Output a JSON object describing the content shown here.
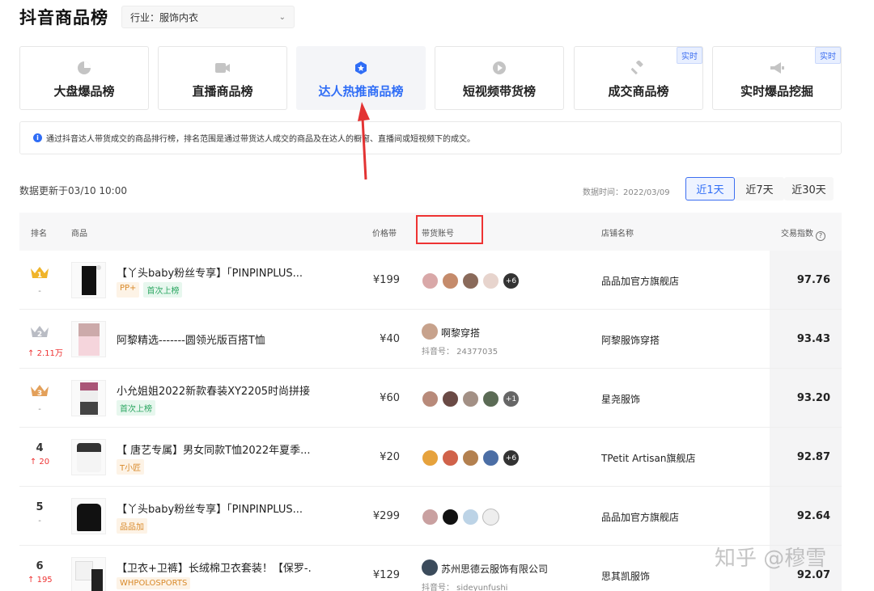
{
  "header": {
    "title": "抖音商品榜",
    "industry_select": "行业：服饰内衣"
  },
  "tabs": [
    {
      "label": "大盘爆品榜",
      "icon": "pie-chart-icon",
      "badge": ""
    },
    {
      "label": "直播商品榜",
      "icon": "video-camera-icon",
      "badge": ""
    },
    {
      "label": "达人热推商品榜",
      "icon": "star-badge-icon",
      "badge": "",
      "active": true
    },
    {
      "label": "短视频带货榜",
      "icon": "play-circle-icon",
      "badge": ""
    },
    {
      "label": "成交商品榜",
      "icon": "gavel-icon",
      "badge": "实时"
    },
    {
      "label": "实时爆品挖掘",
      "icon": "megaphone-icon",
      "badge": "实时"
    }
  ],
  "info": {
    "text": "通过抖音达人带货成交的商品排行榜，排名范围是通过带货达人成交的商品及在达人的橱窗、直播间或短视频下的成交。"
  },
  "update": {
    "text": "数据更新于03/10 10:00",
    "data_date": "数据时间：2022/03/09",
    "ranges": [
      "近1天",
      "近7天",
      "近30天"
    ],
    "active_range": "近1天"
  },
  "table": {
    "headers": {
      "rank": "排名",
      "product": "商品",
      "price": "价格带",
      "account": "带货账号",
      "shop": "店铺名称",
      "score": "交易指数"
    },
    "rows": [
      {
        "rank": "1",
        "crown": "gold",
        "change": "-",
        "change_dir": "none",
        "name": "【丫头baby粉丝专享】「PINPINPLUS...",
        "tags": [
          {
            "text": "PP+",
            "style": "orange"
          },
          {
            "text": "首次上榜",
            "style": "green"
          }
        ],
        "price": "¥199",
        "accounts": {
          "type": "avatars",
          "count": 4,
          "more": "+6"
        },
        "shop": "品品加官方旗舰店",
        "score": "97.76"
      },
      {
        "rank": "2",
        "crown": "silver",
        "change": "2.11万",
        "change_dir": "up",
        "name": "阿黎精选-------圆领光版百搭T恤",
        "tags": [],
        "price": "¥40",
        "accounts": {
          "type": "single",
          "name": "啊黎穿搭",
          "id": "抖音号： 24377035"
        },
        "shop": "阿黎服饰穿搭",
        "score": "93.43"
      },
      {
        "rank": "3",
        "crown": "bronze",
        "change": "-",
        "change_dir": "none",
        "name": "小允姐姐2022新款春装XY2205时尚拼接...",
        "tags": [
          {
            "text": "首次上榜",
            "style": "green"
          }
        ],
        "price": "¥60",
        "accounts": {
          "type": "avatars",
          "count": 4,
          "more": "+1"
        },
        "shop": "星尧服饰",
        "score": "93.20"
      },
      {
        "rank": "4",
        "crown": "",
        "change": "20",
        "change_dir": "up",
        "name": "【 唐艺专属】男女同款T恤2022年夏季...",
        "tags": [
          {
            "text": "T小匠",
            "style": "orange"
          }
        ],
        "price": "¥20",
        "accounts": {
          "type": "avatars",
          "count": 4,
          "more": "+6"
        },
        "shop": "TPetit Artisan旗舰店",
        "score": "92.87"
      },
      {
        "rank": "5",
        "crown": "",
        "change": "-",
        "change_dir": "none",
        "name": "【丫头baby粉丝专享】「PINPINPLUS...",
        "tags": [
          {
            "text": "品品加",
            "style": "orange"
          }
        ],
        "price": "¥299",
        "accounts": {
          "type": "avatars",
          "count": 4,
          "more": ""
        },
        "shop": "品品加官方旗舰店",
        "score": "92.64"
      },
      {
        "rank": "6",
        "crown": "",
        "change": "195",
        "change_dir": "up",
        "name": "【卫衣+卫裤】长绒棉卫衣套装！【保罗-...",
        "tags": [
          {
            "text": "WHPOLOSPORTS",
            "style": "orange"
          }
        ],
        "price": "¥129",
        "accounts": {
          "type": "single",
          "name": "苏州思德云服饰有限公司",
          "id": "抖音号： sideyunfushi"
        },
        "shop": "思其凯服饰",
        "score": "92.07"
      }
    ]
  },
  "watermark": "知乎 @穆雪",
  "colors": {
    "accent": "#2f6df6",
    "annotation_red": "#e33333",
    "gold": "#f0b429",
    "silver": "#b9bcc4",
    "bronze": "#e3a05a"
  }
}
